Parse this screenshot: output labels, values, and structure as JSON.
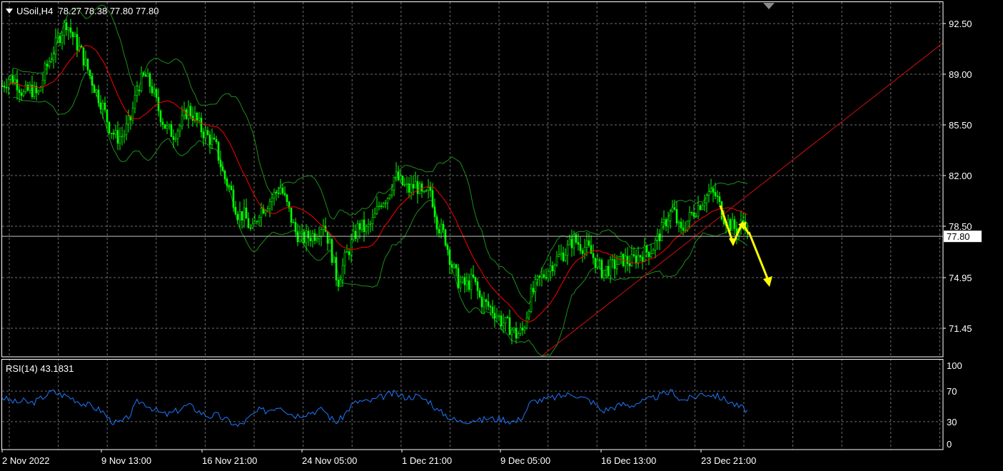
{
  "header": {
    "symbol": "USoil,H4",
    "ohlc": "78.27 78.38 77.80 77.80"
  },
  "rsi_label": "RSI(14) 43.1831",
  "colors": {
    "background": "#000000",
    "grid": "#6e6e6e",
    "candle": "#00ff00",
    "moving_average": "#ff0000",
    "bollinger": "#1a8f1a",
    "rsi": "#1e78ff",
    "trendline": "#d01010",
    "arrow": "#ffff00",
    "price_line": "#c0c0c0"
  },
  "chart_data": [
    {
      "type": "line",
      "subtype": "candlestick",
      "x_labels": [
        "2 Nov 2022",
        "9 Nov 13:00",
        "16 Nov 21:00",
        "24 Nov 05:00",
        "1 Dec 21:00",
        "9 Dec 05:00",
        "16 Dec 13:00",
        "23 Dec 21:00"
      ],
      "y_ticks": [
        "92.50",
        "89.00",
        "85.50",
        "82.00",
        "78.50",
        "74.95",
        "71.45"
      ],
      "ylim": [
        70.0,
        94.0
      ],
      "current_price": "77.80",
      "grid": true,
      "close_path": [
        {
          "x": 0,
          "y": 88.2
        },
        {
          "x": 10,
          "y": 88.8
        },
        {
          "x": 20,
          "y": 88.5
        },
        {
          "x": 30,
          "y": 87.6
        },
        {
          "x": 40,
          "y": 88.0
        },
        {
          "x": 50,
          "y": 87.5
        },
        {
          "x": 60,
          "y": 89.2
        },
        {
          "x": 70,
          "y": 90.4
        },
        {
          "x": 80,
          "y": 91.6
        },
        {
          "x": 90,
          "y": 92.6
        },
        {
          "x": 100,
          "y": 91.5
        },
        {
          "x": 110,
          "y": 90.6
        },
        {
          "x": 120,
          "y": 89.3
        },
        {
          "x": 130,
          "y": 88.0
        },
        {
          "x": 140,
          "y": 86.9
        },
        {
          "x": 150,
          "y": 85.4
        },
        {
          "x": 160,
          "y": 84.6
        },
        {
          "x": 170,
          "y": 84.8
        },
        {
          "x": 180,
          "y": 85.9
        },
        {
          "x": 190,
          "y": 88.2
        },
        {
          "x": 200,
          "y": 88.9
        },
        {
          "x": 210,
          "y": 88.0
        },
        {
          "x": 220,
          "y": 86.4
        },
        {
          "x": 230,
          "y": 85.2
        },
        {
          "x": 240,
          "y": 84.9
        },
        {
          "x": 250,
          "y": 85.5
        },
        {
          "x": 260,
          "y": 86.6
        },
        {
          "x": 270,
          "y": 86.0
        },
        {
          "x": 280,
          "y": 85.1
        },
        {
          "x": 290,
          "y": 84.6
        },
        {
          "x": 300,
          "y": 83.9
        },
        {
          "x": 310,
          "y": 82.0
        },
        {
          "x": 320,
          "y": 81.0
        },
        {
          "x": 330,
          "y": 79.4
        },
        {
          "x": 340,
          "y": 79.2
        },
        {
          "x": 350,
          "y": 78.0
        },
        {
          "x": 360,
          "y": 79.6
        },
        {
          "x": 370,
          "y": 80.0
        },
        {
          "x": 380,
          "y": 80.6
        },
        {
          "x": 390,
          "y": 81.2
        },
        {
          "x": 400,
          "y": 79.8
        },
        {
          "x": 410,
          "y": 78.2
        },
        {
          "x": 420,
          "y": 77.6
        },
        {
          "x": 430,
          "y": 77.8
        },
        {
          "x": 440,
          "y": 78.0
        },
        {
          "x": 450,
          "y": 78.8
        },
        {
          "x": 460,
          "y": 77.0
        },
        {
          "x": 470,
          "y": 74.6
        },
        {
          "x": 480,
          "y": 76.2
        },
        {
          "x": 490,
          "y": 77.4
        },
        {
          "x": 500,
          "y": 78.6
        },
        {
          "x": 510,
          "y": 78.2
        },
        {
          "x": 520,
          "y": 78.9
        },
        {
          "x": 530,
          "y": 80.2
        },
        {
          "x": 540,
          "y": 80.6
        },
        {
          "x": 550,
          "y": 82.0
        },
        {
          "x": 560,
          "y": 81.4
        },
        {
          "x": 570,
          "y": 81.0
        },
        {
          "x": 580,
          "y": 81.4
        },
        {
          "x": 590,
          "y": 80.4
        },
        {
          "x": 600,
          "y": 81.0
        },
        {
          "x": 610,
          "y": 78.6
        },
        {
          "x": 620,
          "y": 77.8
        },
        {
          "x": 630,
          "y": 75.8
        },
        {
          "x": 640,
          "y": 74.6
        },
        {
          "x": 650,
          "y": 74.4
        },
        {
          "x": 660,
          "y": 74.8
        },
        {
          "x": 670,
          "y": 73.4
        },
        {
          "x": 680,
          "y": 73.0
        },
        {
          "x": 690,
          "y": 72.6
        },
        {
          "x": 700,
          "y": 71.9
        },
        {
          "x": 710,
          "y": 71.6
        },
        {
          "x": 720,
          "y": 71.0
        },
        {
          "x": 730,
          "y": 71.3
        },
        {
          "x": 740,
          "y": 73.6
        },
        {
          "x": 750,
          "y": 74.6
        },
        {
          "x": 760,
          "y": 75.2
        },
        {
          "x": 770,
          "y": 75.9
        },
        {
          "x": 780,
          "y": 76.4
        },
        {
          "x": 790,
          "y": 76.8
        },
        {
          "x": 800,
          "y": 77.6
        },
        {
          "x": 810,
          "y": 77.2
        },
        {
          "x": 820,
          "y": 77.0
        },
        {
          "x": 830,
          "y": 76.2
        },
        {
          "x": 840,
          "y": 75.4
        },
        {
          "x": 850,
          "y": 75.6
        },
        {
          "x": 860,
          "y": 75.9
        },
        {
          "x": 870,
          "y": 76.2
        },
        {
          "x": 880,
          "y": 76.0
        },
        {
          "x": 890,
          "y": 76.4
        },
        {
          "x": 900,
          "y": 76.7
        },
        {
          "x": 910,
          "y": 76.9
        },
        {
          "x": 920,
          "y": 77.8
        },
        {
          "x": 930,
          "y": 78.9
        },
        {
          "x": 940,
          "y": 79.7
        },
        {
          "x": 950,
          "y": 78.0
        },
        {
          "x": 960,
          "y": 78.9
        },
        {
          "x": 970,
          "y": 79.6
        },
        {
          "x": 980,
          "y": 80.2
        },
        {
          "x": 990,
          "y": 80.8
        },
        {
          "x": 1000,
          "y": 80.6
        },
        {
          "x": 1010,
          "y": 79.2
        },
        {
          "x": 1020,
          "y": 78.6
        },
        {
          "x": 1030,
          "y": 78.2
        },
        {
          "x": 1040,
          "y": 79.0
        },
        {
          "x": 1045,
          "y": 77.8
        }
      ],
      "overlays": [
        "candlesticks",
        "moving_average",
        "bollinger_bands",
        "trendline",
        "forecast_arrows",
        "current_price_line"
      ]
    },
    {
      "type": "line",
      "name": "RSI(14) 43.1831",
      "y_ticks": [
        "100",
        "70",
        "30",
        "0"
      ],
      "ylim": [
        0,
        100
      ],
      "grid": true,
      "values": [
        {
          "x": 0,
          "y": 62
        },
        {
          "x": 10,
          "y": 58
        },
        {
          "x": 20,
          "y": 55
        },
        {
          "x": 30,
          "y": 57
        },
        {
          "x": 40,
          "y": 54
        },
        {
          "x": 50,
          "y": 58
        },
        {
          "x": 60,
          "y": 64
        },
        {
          "x": 70,
          "y": 70
        },
        {
          "x": 80,
          "y": 66
        },
        {
          "x": 90,
          "y": 64
        },
        {
          "x": 100,
          "y": 60
        },
        {
          "x": 110,
          "y": 55
        },
        {
          "x": 120,
          "y": 52
        },
        {
          "x": 130,
          "y": 48
        },
        {
          "x": 140,
          "y": 44
        },
        {
          "x": 150,
          "y": 33
        },
        {
          "x": 160,
          "y": 28
        },
        {
          "x": 170,
          "y": 30
        },
        {
          "x": 180,
          "y": 40
        },
        {
          "x": 190,
          "y": 57
        },
        {
          "x": 200,
          "y": 54
        },
        {
          "x": 210,
          "y": 48
        },
        {
          "x": 220,
          "y": 42
        },
        {
          "x": 230,
          "y": 39
        },
        {
          "x": 240,
          "y": 42
        },
        {
          "x": 250,
          "y": 47
        },
        {
          "x": 260,
          "y": 52
        },
        {
          "x": 270,
          "y": 47
        },
        {
          "x": 280,
          "y": 41
        },
        {
          "x": 290,
          "y": 37
        },
        {
          "x": 300,
          "y": 39
        },
        {
          "x": 310,
          "y": 34
        },
        {
          "x": 320,
          "y": 30
        },
        {
          "x": 330,
          "y": 24
        },
        {
          "x": 340,
          "y": 30
        },
        {
          "x": 350,
          "y": 38
        },
        {
          "x": 360,
          "y": 45
        },
        {
          "x": 370,
          "y": 44
        },
        {
          "x": 380,
          "y": 48
        },
        {
          "x": 390,
          "y": 51
        },
        {
          "x": 400,
          "y": 43
        },
        {
          "x": 410,
          "y": 38
        },
        {
          "x": 420,
          "y": 40
        },
        {
          "x": 430,
          "y": 42
        },
        {
          "x": 440,
          "y": 44
        },
        {
          "x": 450,
          "y": 46
        },
        {
          "x": 460,
          "y": 35
        },
        {
          "x": 470,
          "y": 29
        },
        {
          "x": 480,
          "y": 40
        },
        {
          "x": 490,
          "y": 52
        },
        {
          "x": 500,
          "y": 57
        },
        {
          "x": 510,
          "y": 56
        },
        {
          "x": 520,
          "y": 58
        },
        {
          "x": 530,
          "y": 62
        },
        {
          "x": 540,
          "y": 65
        },
        {
          "x": 550,
          "y": 67
        },
        {
          "x": 560,
          "y": 63
        },
        {
          "x": 570,
          "y": 62
        },
        {
          "x": 580,
          "y": 64
        },
        {
          "x": 590,
          "y": 60
        },
        {
          "x": 600,
          "y": 56
        },
        {
          "x": 610,
          "y": 44
        },
        {
          "x": 620,
          "y": 40
        },
        {
          "x": 630,
          "y": 34
        },
        {
          "x": 640,
          "y": 30
        },
        {
          "x": 650,
          "y": 31
        },
        {
          "x": 660,
          "y": 33
        },
        {
          "x": 670,
          "y": 31
        },
        {
          "x": 680,
          "y": 35
        },
        {
          "x": 690,
          "y": 33
        },
        {
          "x": 700,
          "y": 34
        },
        {
          "x": 710,
          "y": 31
        },
        {
          "x": 720,
          "y": 30
        },
        {
          "x": 730,
          "y": 38
        },
        {
          "x": 740,
          "y": 55
        },
        {
          "x": 750,
          "y": 58
        },
        {
          "x": 760,
          "y": 59
        },
        {
          "x": 770,
          "y": 61
        },
        {
          "x": 780,
          "y": 63
        },
        {
          "x": 790,
          "y": 65
        },
        {
          "x": 800,
          "y": 67
        },
        {
          "x": 810,
          "y": 62
        },
        {
          "x": 820,
          "y": 59
        },
        {
          "x": 830,
          "y": 54
        },
        {
          "x": 840,
          "y": 44
        },
        {
          "x": 850,
          "y": 47
        },
        {
          "x": 860,
          "y": 50
        },
        {
          "x": 870,
          "y": 53
        },
        {
          "x": 880,
          "y": 51
        },
        {
          "x": 890,
          "y": 55
        },
        {
          "x": 900,
          "y": 57
        },
        {
          "x": 910,
          "y": 60
        },
        {
          "x": 920,
          "y": 64
        },
        {
          "x": 930,
          "y": 67
        },
        {
          "x": 940,
          "y": 70
        },
        {
          "x": 950,
          "y": 58
        },
        {
          "x": 960,
          "y": 60
        },
        {
          "x": 970,
          "y": 62
        },
        {
          "x": 980,
          "y": 67
        },
        {
          "x": 990,
          "y": 66
        },
        {
          "x": 1000,
          "y": 64
        },
        {
          "x": 1010,
          "y": 60
        },
        {
          "x": 1020,
          "y": 56
        },
        {
          "x": 1030,
          "y": 50
        },
        {
          "x": 1040,
          "y": 47
        },
        {
          "x": 1045,
          "y": 43
        }
      ]
    }
  ]
}
